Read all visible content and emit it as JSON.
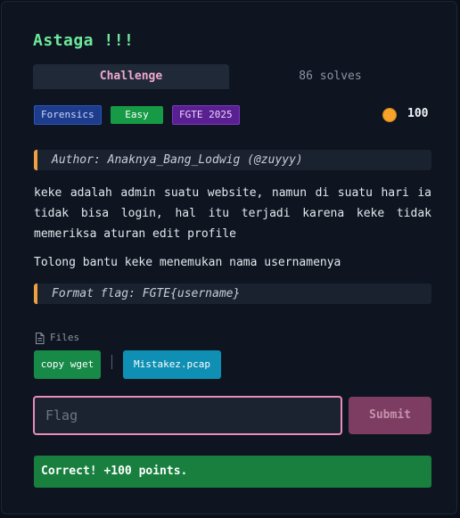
{
  "challenge": {
    "title": "Astaga !!!",
    "tabs": {
      "challenge": "Challenge",
      "solves": "86 solves"
    },
    "tags": {
      "category": "Forensics",
      "difficulty": "Easy",
      "event": "FGTE 2025"
    },
    "points": "100",
    "author": "Author: Anaknya_Bang_Lodwig (@zuyyy)",
    "description": "keke adalah admin suatu website, namun di suatu hari ia tidak bisa login, hal itu terjadi karena keke tidak memeriksa aturan edit profile",
    "description2": "Tolong bantu keke menemukan nama usernamenya",
    "flag_format": "Format flag: FGTE{username}"
  },
  "files": {
    "label": "Files",
    "wget_button": "copy wget",
    "file_name": "Mistakez.pcap"
  },
  "form": {
    "placeholder": "Flag",
    "value": "",
    "submit_label": "Submit"
  },
  "status": {
    "message": "Correct! +100 points."
  },
  "colors": {
    "title": "#6ee99a",
    "accent_pink": "#e98bbb",
    "success": "#187f3e",
    "coin": "#f6a32a"
  },
  "icons": {
    "points": "coin-icon",
    "files": "file-icon"
  }
}
